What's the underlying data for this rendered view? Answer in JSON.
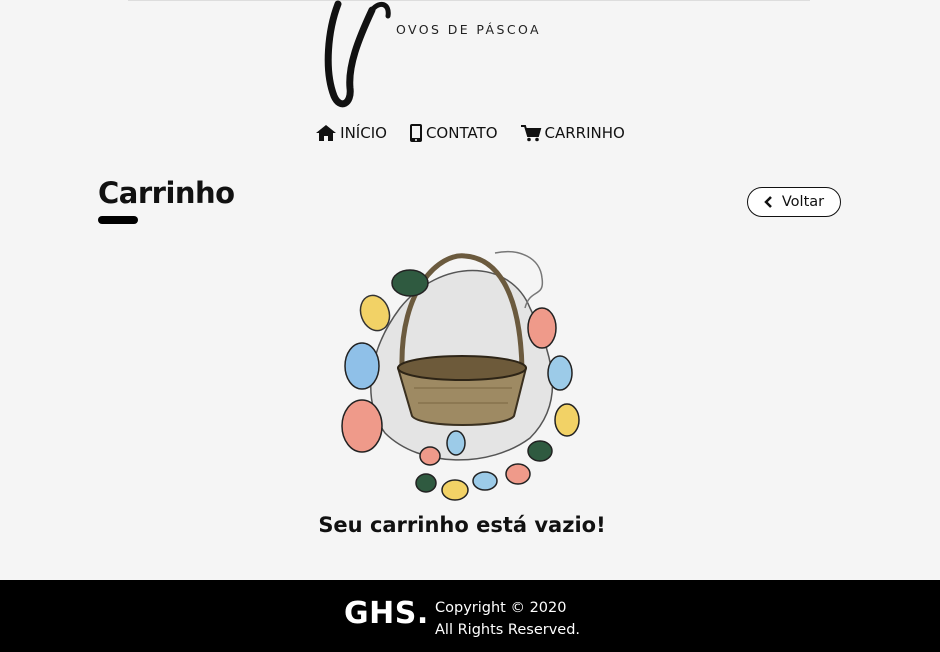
{
  "brand": {
    "subtitle": "OVOS DE PÁSCOA"
  },
  "nav": {
    "items": [
      {
        "label": "INÍCIO",
        "icon": "home-icon"
      },
      {
        "label": "CONTATO",
        "icon": "phone-icon"
      },
      {
        "label": "CARRINHO",
        "icon": "cart-icon"
      }
    ]
  },
  "page": {
    "title": "Carrinho",
    "back_label": "Voltar"
  },
  "cart": {
    "empty_message": "Seu carrinho está vazio!"
  },
  "footer": {
    "brand": "GHS.",
    "copyright": "Copyright © 2020",
    "rights": "All Rights Reserved."
  }
}
